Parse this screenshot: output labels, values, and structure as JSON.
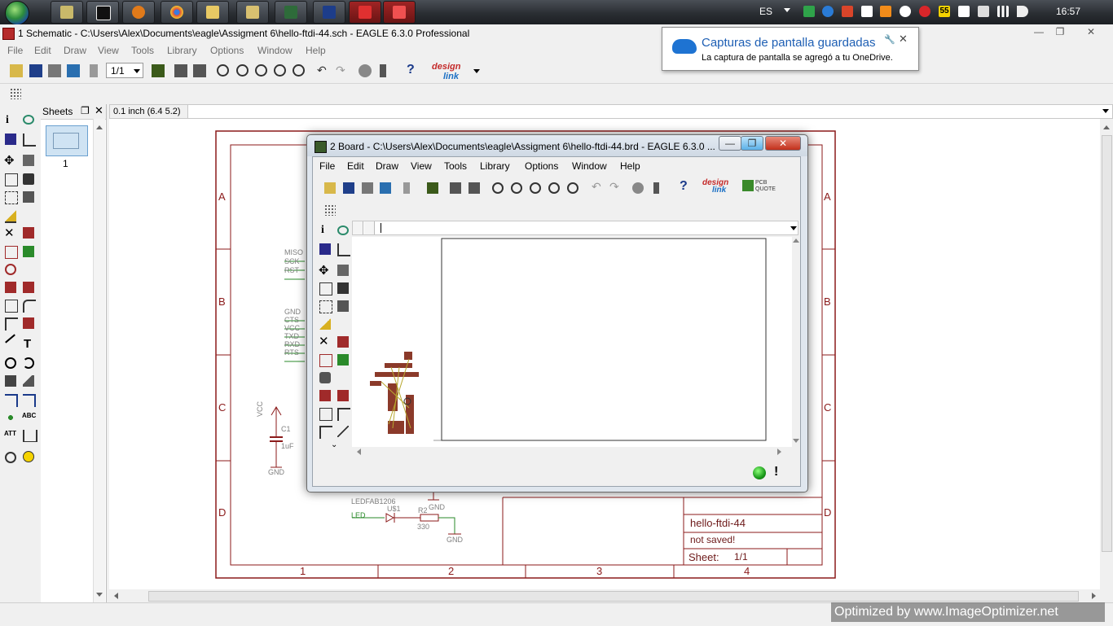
{
  "taskbar": {
    "language": "ES",
    "clock": "16:57",
    "badge_count": "55"
  },
  "main_window": {
    "title": "1 Schematic - C:\\Users\\Alex\\Documents\\eagle\\Assigment 6\\hello-ftdi-44.sch - EAGLE 6.3.0 Professional",
    "menu": [
      "File",
      "Edit",
      "Draw",
      "View",
      "Tools",
      "Library",
      "Options",
      "Window",
      "Help"
    ],
    "zoom_select": "1/1",
    "designlink_label": "design",
    "designlink_label2": "link",
    "coordinate": "0.1 inch (6.4 5.2)",
    "sheets_title": "Sheets",
    "sheet_number": "1"
  },
  "schematic": {
    "frame_rows": [
      "A",
      "B",
      "C",
      "D"
    ],
    "frame_cols": [
      "1",
      "2",
      "3",
      "4"
    ],
    "nets_top": [
      "MISO",
      "SCK",
      "RST"
    ],
    "nets_mid": [
      "GND",
      "CTS",
      "VCC",
      "TXD",
      "RXD",
      "RTS"
    ],
    "vcc": "VCC",
    "c1_name": "C1",
    "c1_value": "1uF",
    "gnd": "GND",
    "led_part": "LEDFAB1206",
    "led_net": "LED",
    "u1": "U$1",
    "r2": "R2",
    "r2_value": "330",
    "title_block": {
      "name": "hello-ftdi-44",
      "status": "not saved!",
      "sheet_label": "Sheet:",
      "sheet_value": "1/1"
    }
  },
  "board_window": {
    "title": "2 Board - C:\\Users\\Alex\\Documents\\eagle\\Assigment 6\\hello-ftdi-44.brd - EAGLE 6.3.0 ...",
    "menu": [
      "File",
      "Edit",
      "Draw",
      "View",
      "Tools",
      "Library",
      "Options",
      "Window",
      "Help"
    ],
    "pcb_quote": "PCB",
    "pcb_quote2": "QUOTE",
    "status_exclaim": "!"
  },
  "toast": {
    "title": "Capturas de pantalla guardadas",
    "body": "La captura de pantalla se agregó a tu OneDrive."
  },
  "watermark": "Optimized by www.ImageOptimizer.net"
}
